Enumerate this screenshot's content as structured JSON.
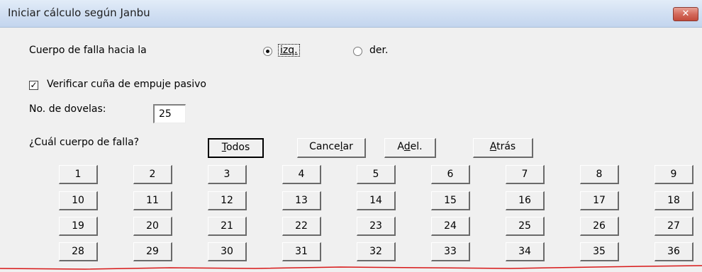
{
  "window": {
    "title": "Iniciar cálculo según Janbu",
    "close_glyph": "✕"
  },
  "form": {
    "direction_label": "Cuerpo de falla hacia la",
    "radio_left_label": "izq.",
    "radio_right_label": "der.",
    "selected_direction": "izq.",
    "verify_label": "Verificar cuña de empuje pasivo",
    "verify_checked": true,
    "slices_label": "No. de dovelas:",
    "slices_value": "25",
    "which_label": "¿Cuál cuerpo de falla?"
  },
  "buttons": {
    "todos": "Todos",
    "cancelar": "Cancelar",
    "adel": "Adel.",
    "atras": "Atrás"
  },
  "numbers": [
    "1",
    "2",
    "3",
    "4",
    "5",
    "6",
    "7",
    "8",
    "9",
    "10",
    "11",
    "12",
    "13",
    "14",
    "15",
    "16",
    "17",
    "18",
    "19",
    "20",
    "21",
    "22",
    "23",
    "24",
    "25",
    "26",
    "27",
    "28",
    "29",
    "30",
    "31",
    "32",
    "33",
    "34",
    "35",
    "36"
  ],
  "colors": {
    "close_button": "#c24a3a",
    "annotation_line": "#d81818"
  }
}
